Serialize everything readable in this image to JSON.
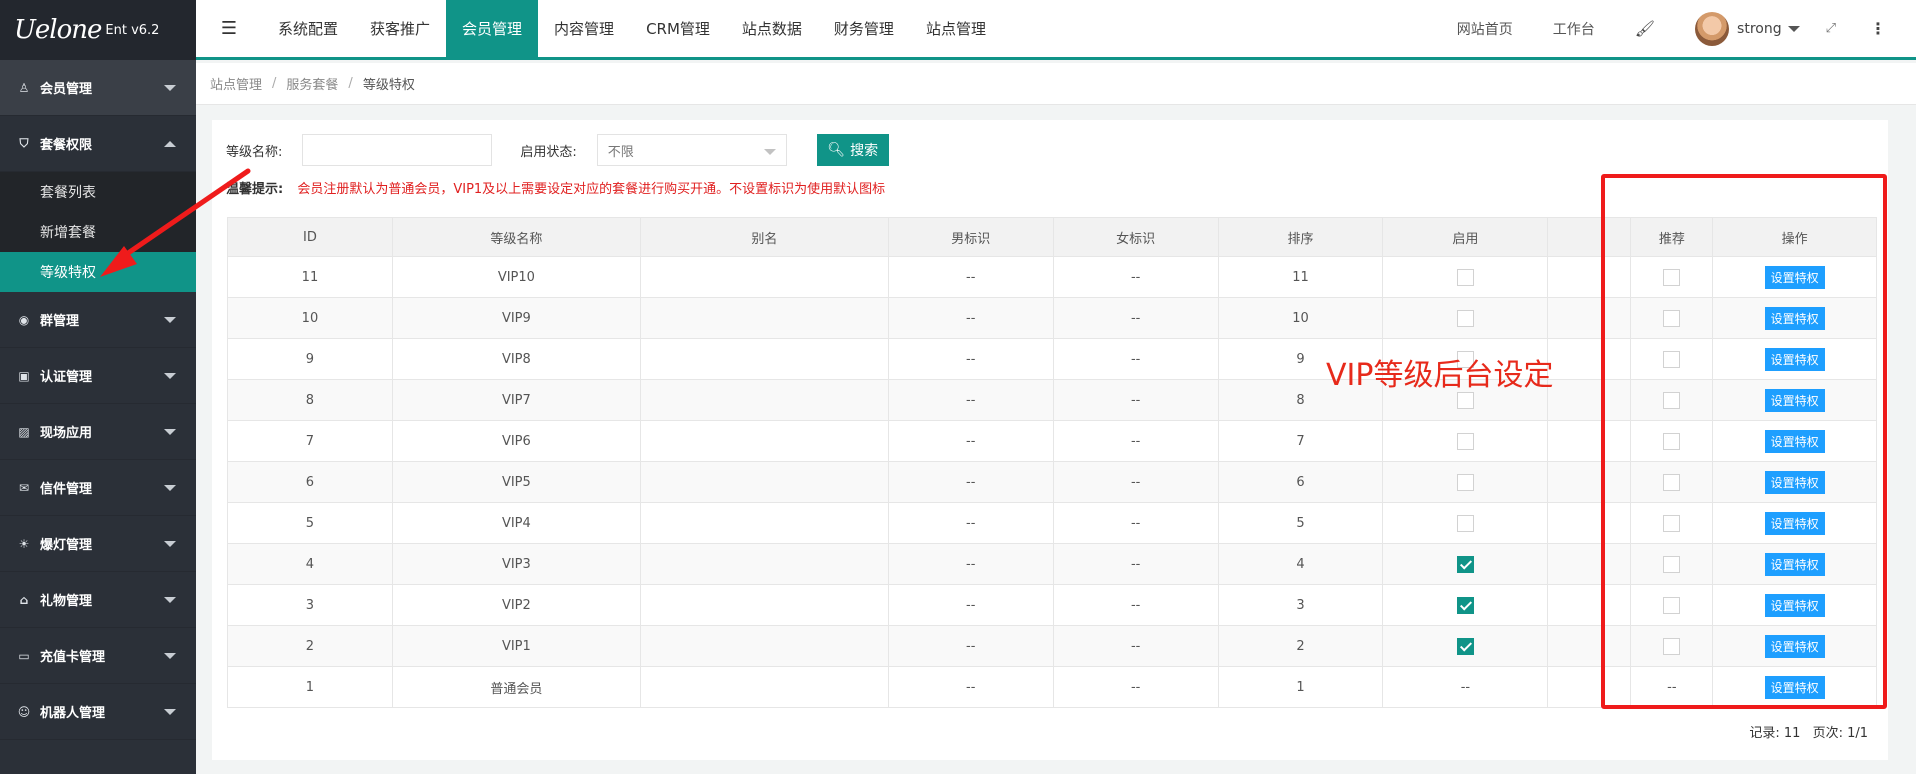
{
  "app": {
    "logo_text": "Uelone",
    "version": "Ent v6.2"
  },
  "sidebar": {
    "items": [
      {
        "label": "会员管理",
        "icon": "user-icon",
        "expanded": false
      },
      {
        "label": "套餐权限",
        "icon": "shield-icon",
        "expanded": true,
        "children": [
          {
            "label": "套餐列表",
            "active": false
          },
          {
            "label": "新增套餐",
            "active": false
          },
          {
            "label": "等级特权",
            "active": true
          }
        ]
      },
      {
        "label": "群管理",
        "icon": "target-icon",
        "expanded": false
      },
      {
        "label": "认证管理",
        "icon": "id-card-icon",
        "expanded": false
      },
      {
        "label": "现场应用",
        "icon": "image-icon",
        "expanded": false
      },
      {
        "label": "信件管理",
        "icon": "mail-icon",
        "expanded": false
      },
      {
        "label": "爆灯管理",
        "icon": "bulb-icon",
        "expanded": false
      },
      {
        "label": "礼物管理",
        "icon": "gift-icon",
        "expanded": false
      },
      {
        "label": "充值卡管理",
        "icon": "card-icon",
        "expanded": false
      },
      {
        "label": "机器人管理",
        "icon": "robot-icon",
        "expanded": false
      }
    ]
  },
  "header": {
    "tabs": [
      {
        "label": "系统配置",
        "active": false
      },
      {
        "label": "获客推广",
        "active": false
      },
      {
        "label": "会员管理",
        "active": true
      },
      {
        "label": "内容管理",
        "active": false
      },
      {
        "label": "CRM管理",
        "active": false
      },
      {
        "label": "站点数据",
        "active": false
      },
      {
        "label": "财务管理",
        "active": false
      },
      {
        "label": "站点管理",
        "active": false
      }
    ],
    "site_home": "网站首页",
    "workbench": "工作台",
    "user_name": "strong"
  },
  "breadcrumb": {
    "items": [
      "站点管理",
      "服务套餐",
      "等级特权"
    ]
  },
  "filter": {
    "name_label": "等级名称:",
    "name_value": "",
    "status_label": "启用状态:",
    "status_value": "不限",
    "search_label": "搜索"
  },
  "tip": {
    "label": "温馨提示:",
    "text": "会员注册默认为普通会员，VIP1及以上需要设定对应的套餐进行购买开通。不设置标识为使用默认图标"
  },
  "table": {
    "headers": [
      "ID",
      "等级名称",
      "别名",
      "男标识",
      "女标识",
      "排序",
      "启用",
      "",
      "推荐",
      "操作"
    ],
    "rows": [
      {
        "id": "11",
        "name": "VIP10",
        "alias": "",
        "male": "--",
        "female": "--",
        "sort": "11",
        "enabled": false,
        "recommend": false
      },
      {
        "id": "10",
        "name": "VIP9",
        "alias": "",
        "male": "--",
        "female": "--",
        "sort": "10",
        "enabled": false,
        "recommend": false
      },
      {
        "id": "9",
        "name": "VIP8",
        "alias": "",
        "male": "--",
        "female": "--",
        "sort": "9",
        "enabled": false,
        "recommend": false
      },
      {
        "id": "8",
        "name": "VIP7",
        "alias": "",
        "male": "--",
        "female": "--",
        "sort": "8",
        "enabled": false,
        "recommend": false
      },
      {
        "id": "7",
        "name": "VIP6",
        "alias": "",
        "male": "--",
        "female": "--",
        "sort": "7",
        "enabled": false,
        "recommend": false
      },
      {
        "id": "6",
        "name": "VIP5",
        "alias": "",
        "male": "--",
        "female": "--",
        "sort": "6",
        "enabled": false,
        "recommend": false
      },
      {
        "id": "5",
        "name": "VIP4",
        "alias": "",
        "male": "--",
        "female": "--",
        "sort": "5",
        "enabled": false,
        "recommend": false
      },
      {
        "id": "4",
        "name": "VIP3",
        "alias": "",
        "male": "--",
        "female": "--",
        "sort": "4",
        "enabled": true,
        "recommend": false
      },
      {
        "id": "3",
        "name": "VIP2",
        "alias": "",
        "male": "--",
        "female": "--",
        "sort": "3",
        "enabled": true,
        "recommend": false
      },
      {
        "id": "2",
        "name": "VIP1",
        "alias": "",
        "male": "--",
        "female": "--",
        "sort": "2",
        "enabled": true,
        "recommend": false
      },
      {
        "id": "1",
        "name": "普通会员",
        "alias": "",
        "male": "--",
        "female": "--",
        "sort": "1",
        "enabled": null,
        "recommend": null,
        "enabled_text": "--",
        "recommend_text": "--"
      }
    ],
    "action_label": "设置特权"
  },
  "pager": {
    "records": "记录:  11",
    "pages": "页次:  1/1"
  },
  "annotation": {
    "text": "VIP等级后台设定"
  },
  "colors": {
    "accent": "#109488",
    "sidebar_bg": "#2b3038",
    "action_blue": "#1e9fff",
    "annotation_red": "#ef1b1b"
  }
}
